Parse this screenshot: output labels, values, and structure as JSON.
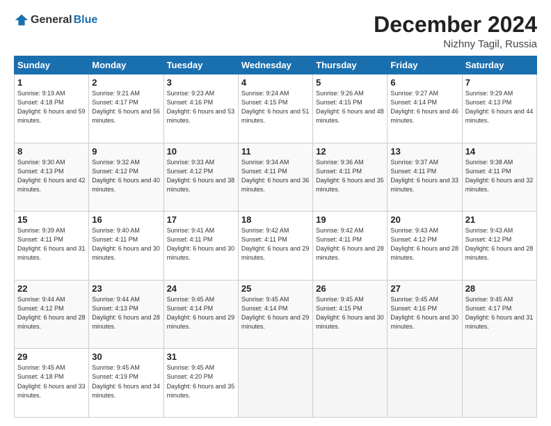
{
  "logo": {
    "general": "General",
    "blue": "Blue"
  },
  "header": {
    "month": "December 2024",
    "location": "Nizhny Tagil, Russia"
  },
  "weekdays": [
    "Sunday",
    "Monday",
    "Tuesday",
    "Wednesday",
    "Thursday",
    "Friday",
    "Saturday"
  ],
  "weeks": [
    [
      {
        "day": "1",
        "sunrise": "9:19 AM",
        "sunset": "4:18 PM",
        "daylight": "6 hours and 59 minutes."
      },
      {
        "day": "2",
        "sunrise": "9:21 AM",
        "sunset": "4:17 PM",
        "daylight": "6 hours and 56 minutes."
      },
      {
        "day": "3",
        "sunrise": "9:23 AM",
        "sunset": "4:16 PM",
        "daylight": "6 hours and 53 minutes."
      },
      {
        "day": "4",
        "sunrise": "9:24 AM",
        "sunset": "4:15 PM",
        "daylight": "6 hours and 51 minutes."
      },
      {
        "day": "5",
        "sunrise": "9:26 AM",
        "sunset": "4:15 PM",
        "daylight": "6 hours and 48 minutes."
      },
      {
        "day": "6",
        "sunrise": "9:27 AM",
        "sunset": "4:14 PM",
        "daylight": "6 hours and 46 minutes."
      },
      {
        "day": "7",
        "sunrise": "9:29 AM",
        "sunset": "4:13 PM",
        "daylight": "6 hours and 44 minutes."
      }
    ],
    [
      {
        "day": "8",
        "sunrise": "9:30 AM",
        "sunset": "4:13 PM",
        "daylight": "6 hours and 42 minutes."
      },
      {
        "day": "9",
        "sunrise": "9:32 AM",
        "sunset": "4:12 PM",
        "daylight": "6 hours and 40 minutes."
      },
      {
        "day": "10",
        "sunrise": "9:33 AM",
        "sunset": "4:12 PM",
        "daylight": "6 hours and 38 minutes."
      },
      {
        "day": "11",
        "sunrise": "9:34 AM",
        "sunset": "4:11 PM",
        "daylight": "6 hours and 36 minutes."
      },
      {
        "day": "12",
        "sunrise": "9:36 AM",
        "sunset": "4:11 PM",
        "daylight": "6 hours and 35 minutes."
      },
      {
        "day": "13",
        "sunrise": "9:37 AM",
        "sunset": "4:11 PM",
        "daylight": "6 hours and 33 minutes."
      },
      {
        "day": "14",
        "sunrise": "9:38 AM",
        "sunset": "4:11 PM",
        "daylight": "6 hours and 32 minutes."
      }
    ],
    [
      {
        "day": "15",
        "sunrise": "9:39 AM",
        "sunset": "4:11 PM",
        "daylight": "6 hours and 31 minutes."
      },
      {
        "day": "16",
        "sunrise": "9:40 AM",
        "sunset": "4:11 PM",
        "daylight": "6 hours and 30 minutes."
      },
      {
        "day": "17",
        "sunrise": "9:41 AM",
        "sunset": "4:11 PM",
        "daylight": "6 hours and 30 minutes."
      },
      {
        "day": "18",
        "sunrise": "9:42 AM",
        "sunset": "4:11 PM",
        "daylight": "6 hours and 29 minutes."
      },
      {
        "day": "19",
        "sunrise": "9:42 AM",
        "sunset": "4:11 PM",
        "daylight": "6 hours and 28 minutes."
      },
      {
        "day": "20",
        "sunrise": "9:43 AM",
        "sunset": "4:12 PM",
        "daylight": "6 hours and 28 minutes."
      },
      {
        "day": "21",
        "sunrise": "9:43 AM",
        "sunset": "4:12 PM",
        "daylight": "6 hours and 28 minutes."
      }
    ],
    [
      {
        "day": "22",
        "sunrise": "9:44 AM",
        "sunset": "4:12 PM",
        "daylight": "6 hours and 28 minutes."
      },
      {
        "day": "23",
        "sunrise": "9:44 AM",
        "sunset": "4:13 PM",
        "daylight": "6 hours and 28 minutes."
      },
      {
        "day": "24",
        "sunrise": "9:45 AM",
        "sunset": "4:14 PM",
        "daylight": "6 hours and 29 minutes."
      },
      {
        "day": "25",
        "sunrise": "9:45 AM",
        "sunset": "4:14 PM",
        "daylight": "6 hours and 29 minutes."
      },
      {
        "day": "26",
        "sunrise": "9:45 AM",
        "sunset": "4:15 PM",
        "daylight": "6 hours and 30 minutes."
      },
      {
        "day": "27",
        "sunrise": "9:45 AM",
        "sunset": "4:16 PM",
        "daylight": "6 hours and 30 minutes."
      },
      {
        "day": "28",
        "sunrise": "9:45 AM",
        "sunset": "4:17 PM",
        "daylight": "6 hours and 31 minutes."
      }
    ],
    [
      {
        "day": "29",
        "sunrise": "9:45 AM",
        "sunset": "4:18 PM",
        "daylight": "6 hours and 33 minutes."
      },
      {
        "day": "30",
        "sunrise": "9:45 AM",
        "sunset": "4:19 PM",
        "daylight": "6 hours and 34 minutes."
      },
      {
        "day": "31",
        "sunrise": "9:45 AM",
        "sunset": "4:20 PM",
        "daylight": "6 hours and 35 minutes."
      },
      null,
      null,
      null,
      null
    ]
  ]
}
